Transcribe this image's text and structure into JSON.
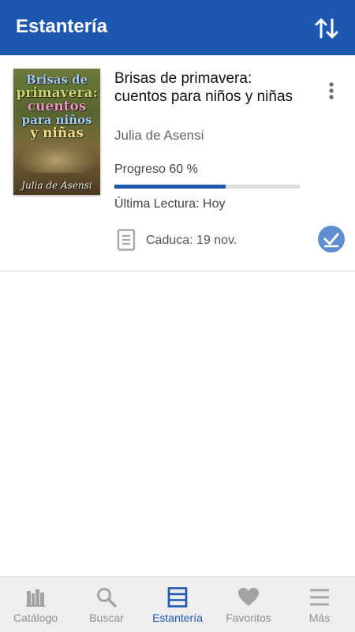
{
  "app_bar": {
    "title": "Estantería",
    "sort_icon": "sort-arrows-icon"
  },
  "book": {
    "cover": {
      "title_lines": [
        "Brisas de",
        "primavera:",
        "cuentos",
        "para niños",
        "y niñas"
      ],
      "author": "Julia de Asensi"
    },
    "title": "Brisas de primavera: cuentos para niños y niñas",
    "author": "Julia de Asensi",
    "progress_label": "Progreso 60 %",
    "progress_fraction": 0.6,
    "last_read": "Última Lectura: Hoy",
    "expires": "Caduca: 19 nov.",
    "menu_icon": "more-vert-icon",
    "doc_icon": "document-icon",
    "return_icon": "check-icon"
  },
  "bottom_nav": {
    "items": [
      {
        "label": "Catálogo",
        "icon": "library-icon",
        "active": false
      },
      {
        "label": "Buscar",
        "icon": "search-icon",
        "active": false
      },
      {
        "label": "Estantería",
        "icon": "shelf-icon",
        "active": true
      },
      {
        "label": "Favoritos",
        "icon": "heart-icon",
        "active": false
      },
      {
        "label": "Más",
        "icon": "menu-icon",
        "active": false
      }
    ]
  },
  "colors": {
    "primary": "#1e57b0",
    "inactive": "#8f8f8f",
    "progress_track": "#dddddd",
    "check_badge": "#5f8fd0"
  }
}
